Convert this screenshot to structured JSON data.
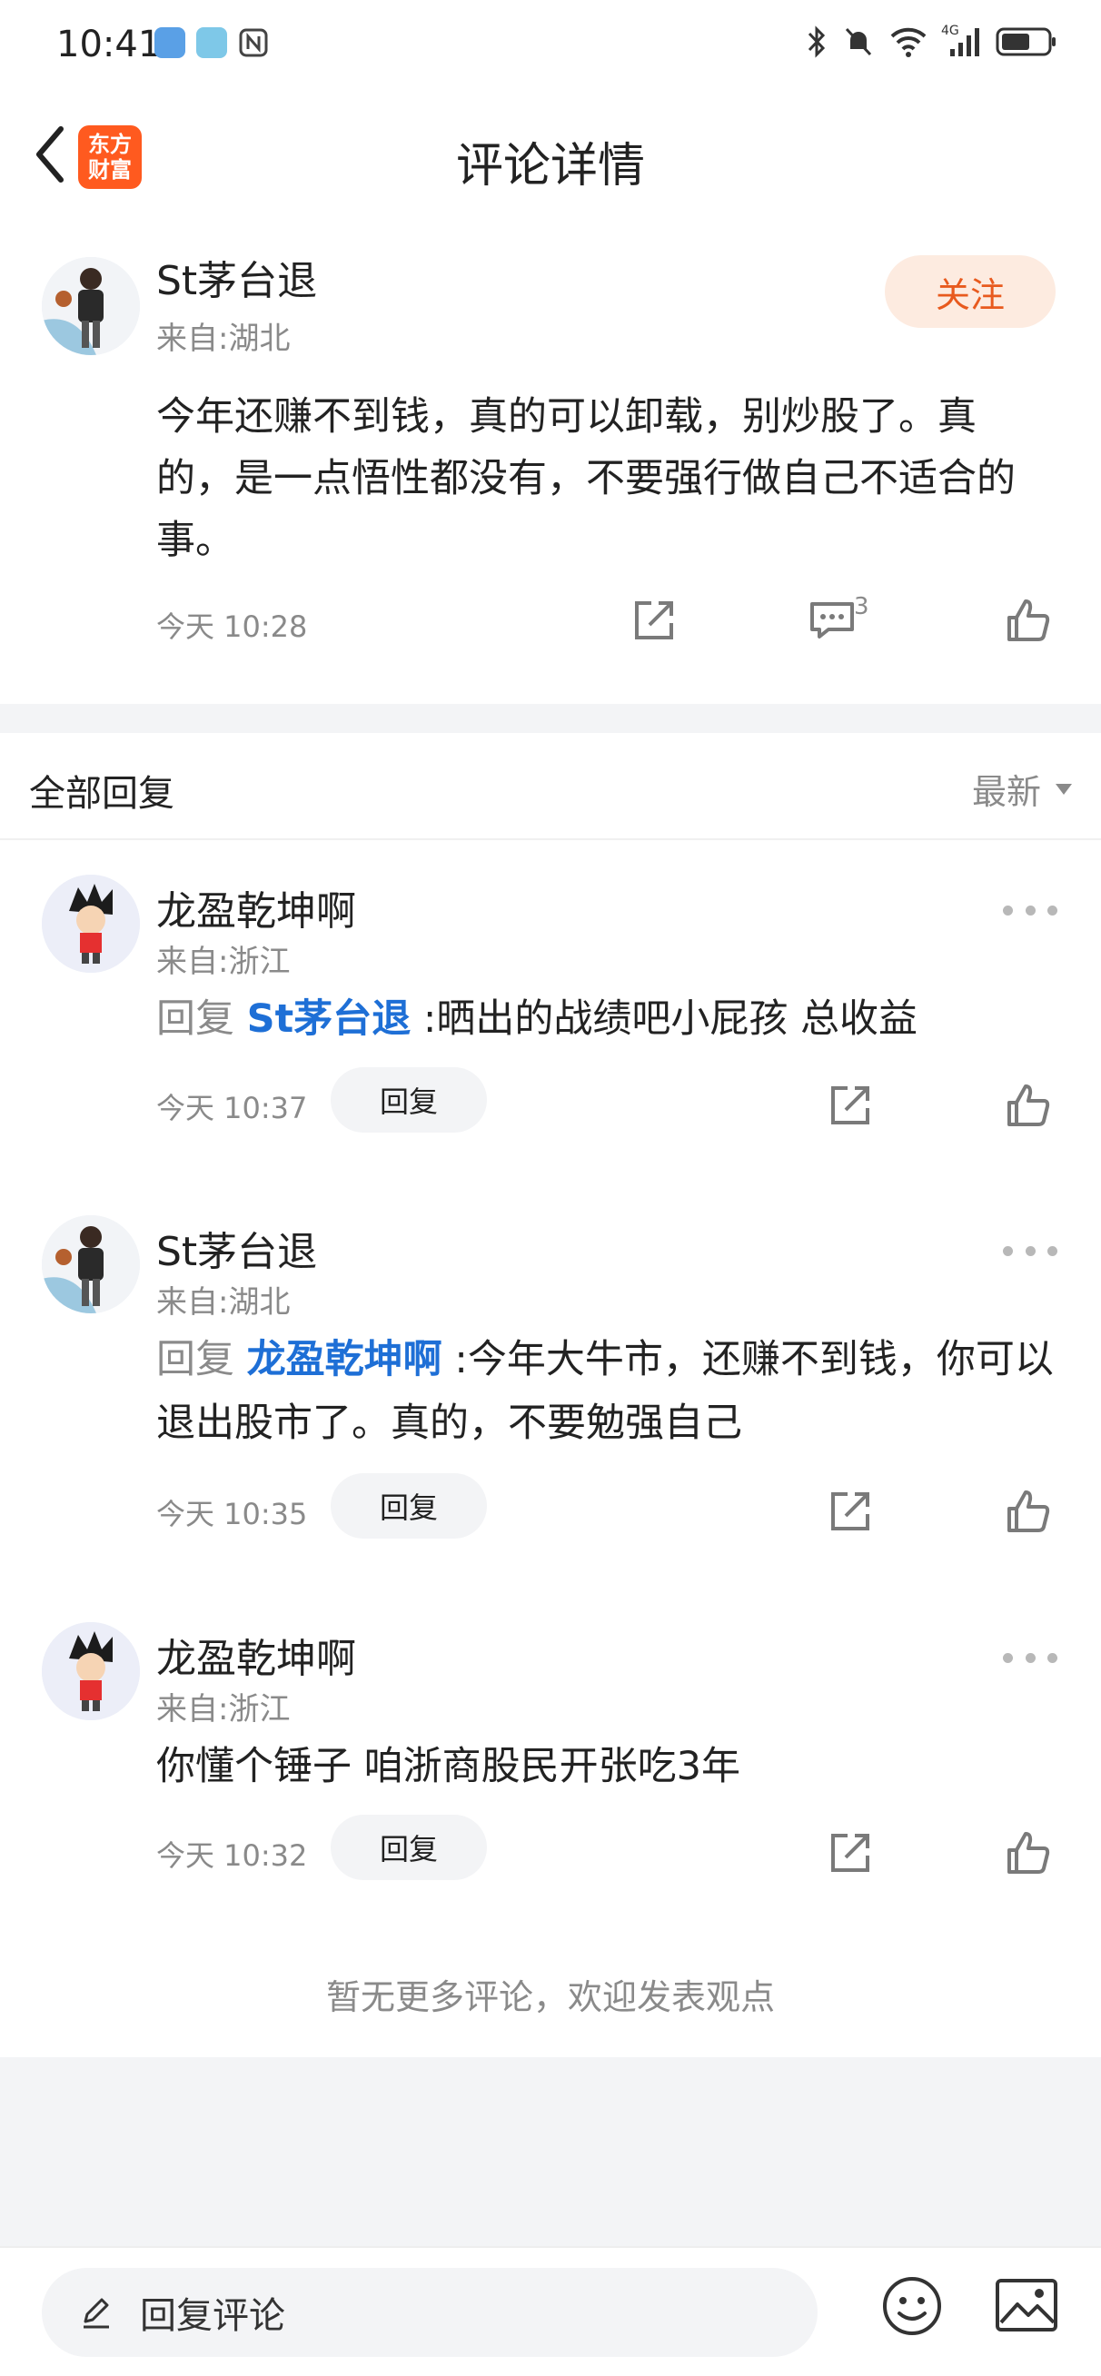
{
  "status_bar": {
    "time": "10:41",
    "network": "4G"
  },
  "header": {
    "title": "评论详情",
    "logo_line1": "东方",
    "logo_line2": "财富"
  },
  "main_comment": {
    "user": "St茅台退",
    "location": "来自:湖北",
    "follow_label": "关注",
    "text": "今年还赚不到钱，真的可以卸载，别炒股了。真的，是一点悟性都没有，不要强行做自己不适合的事。",
    "time": "今天 10:28",
    "comment_count": "3"
  },
  "replies_header": {
    "title": "全部回复",
    "sort_label": "最新"
  },
  "replies": [
    {
      "user": "龙盈乾坤啊",
      "location": "来自:浙江",
      "prefix": "回复",
      "mention": "St茅台退",
      "separator": ":",
      "text": "晒出的战绩吧小屁孩   总收益",
      "time": "今天 10:37",
      "reply_label": "回复"
    },
    {
      "user": "St茅台退",
      "location": "来自:湖北",
      "prefix": "回复",
      "mention": "龙盈乾坤啊",
      "separator": ":",
      "text": "今年大牛市，还赚不到钱，你可以退出股市了。真的，不要勉强自己",
      "time": "今天 10:35",
      "reply_label": "回复"
    },
    {
      "user": "龙盈乾坤啊",
      "location": "来自:浙江",
      "text": "你懂个锤子  咱浙商股民开张吃3年",
      "time": "今天 10:32",
      "reply_label": "回复"
    }
  ],
  "no_more_text": "暂无更多评论，欢迎发表观点",
  "bottom_bar": {
    "reply_placeholder": "回复评论"
  },
  "colors": {
    "accent_orange": "#e85a1e",
    "mention_blue": "#1e6fd6",
    "muted_grey": "#8a8a8a"
  }
}
